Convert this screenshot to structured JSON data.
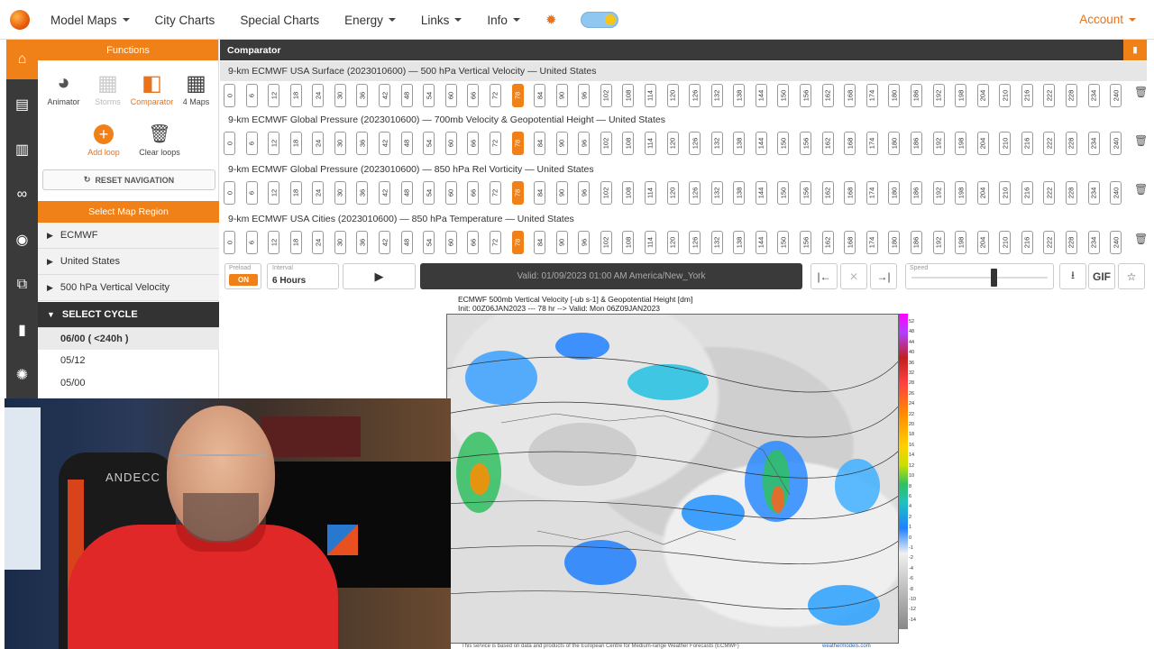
{
  "nav": {
    "items": [
      "Model Maps",
      "City Charts",
      "Special Charts",
      "Energy",
      "Links",
      "Info"
    ],
    "dropdowns": [
      true,
      false,
      false,
      true,
      true,
      true
    ],
    "account": "Account",
    "accent_color": "#f08018"
  },
  "functions": {
    "header": "Functions",
    "items": [
      {
        "label": "Animator",
        "icon": "globe-icon"
      },
      {
        "label": "Storms",
        "icon": "grid-icon"
      },
      {
        "label": "Comparator",
        "icon": "comparator-icon"
      },
      {
        "label": "4 Maps",
        "icon": "four-maps-icon"
      }
    ],
    "add_loop": "Add loop",
    "clear_loops": "Clear loops",
    "reset": "RESET NAVIGATION",
    "region_header": "Select Map Region",
    "accordion": [
      "ECMWF",
      "United States",
      "500 hPa Vertical Velocity"
    ],
    "select_cycle": "SELECT CYCLE",
    "cycles": [
      "06/00 ( <240h )",
      "05/12",
      "05/00"
    ]
  },
  "comparator": {
    "title": "Comparator",
    "rows": [
      {
        "title": "9-km ECMWF USA Surface (2023010600) — 500 hPa Vertical Velocity — United States"
      },
      {
        "title": "9-km ECMWF Global Pressure (2023010600) — 700mb Velocity & Geopotential Height — United States"
      },
      {
        "title": "9-km ECMWF Global Pressure (2023010600) — 850 hPa Rel Vorticity — United States"
      },
      {
        "title": "9-km ECMWF USA Cities (2023010600) — 850 hPa Temperature — United States"
      }
    ],
    "hours": [
      "0",
      "6",
      "12",
      "18",
      "24",
      "30",
      "36",
      "42",
      "48",
      "54",
      "60",
      "66",
      "72",
      "78",
      "84",
      "90",
      "96",
      "102",
      "108",
      "114",
      "120",
      "126",
      "132",
      "138",
      "144",
      "150",
      "156",
      "162",
      "168",
      "174",
      "180",
      "186",
      "192",
      "198",
      "204",
      "210",
      "216",
      "222",
      "228",
      "234",
      "240"
    ],
    "selected_hour": "78"
  },
  "controls": {
    "preload_label": "Preload",
    "preload_value": "ON",
    "interval_label": "Interval",
    "interval_value": "6 Hours",
    "valid_text": "Valid: 01/09/2023 01:00 AM America/New_York",
    "speed_label": "Speed",
    "speed_level": 0.6,
    "gif": "GIF"
  },
  "map": {
    "title_line1": "ECMWF 500mb Vertical Velocity [-ub s-1] & Geopotential Height [dm]",
    "title_line2": "Init: 00Z06JAN2023 --- 78 hr --> Valid: Mon 06Z09JAN2023",
    "colorbar_labels": [
      "52",
      "48",
      "44",
      "40",
      "36",
      "32",
      "28",
      "26",
      "24",
      "22",
      "20",
      "18",
      "16",
      "14",
      "12",
      "10",
      "8",
      "6",
      "4",
      "2",
      "1",
      "0",
      "-1",
      "-2",
      "-4",
      "-6",
      "-8",
      "-10",
      "-12",
      "-14"
    ],
    "credit": "This service is based on data and products of the European Centre for Medium-range Weather Forecasts (ECMWF)",
    "credit_site": "weathermodels.com"
  },
  "webcam": {
    "chair_brand": "ANDECC"
  }
}
